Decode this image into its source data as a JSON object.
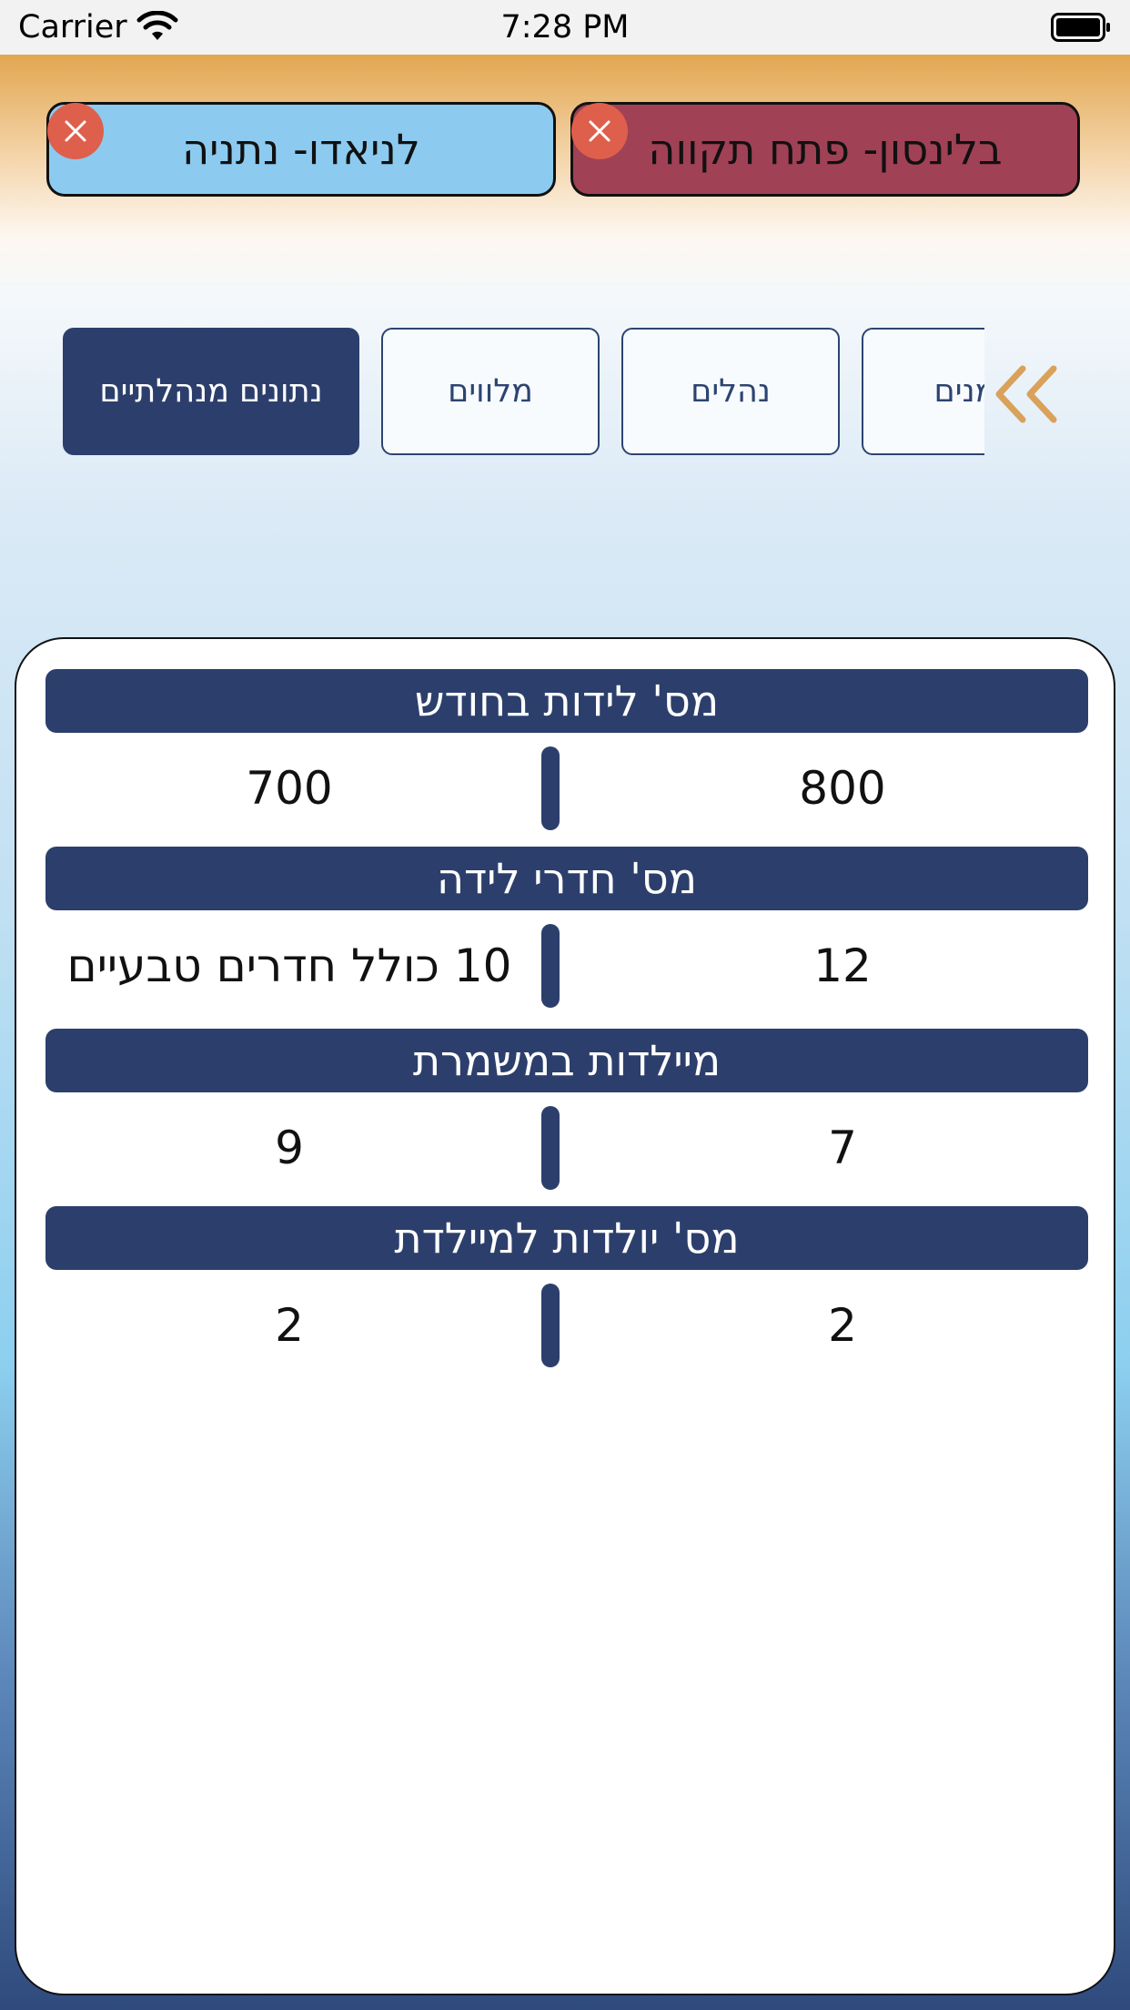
{
  "status_bar": {
    "carrier": "Carrier",
    "time": "7:28 PM"
  },
  "hospitals": {
    "left": "לניאדו- נתניה",
    "right": "בלינסון- פתח תקווה"
  },
  "tabs": [
    {
      "label": "נתונים מנהלתיים",
      "active": true
    },
    {
      "label": "מלווים",
      "active": false
    },
    {
      "label": "נהלים",
      "active": false
    },
    {
      "label": "זמנים",
      "active": false
    }
  ],
  "stats": [
    {
      "title": "מס' לידות בחודש",
      "left_value": "700",
      "right_value": "800"
    },
    {
      "title": "מס' חדרי לידה",
      "left_value": "10 כולל חדרים טבעיים",
      "right_value": "12"
    },
    {
      "title": "מיילדות במשמרת",
      "left_value": "9",
      "right_value": "7"
    },
    {
      "title": "מס' יולדות למיילדת",
      "left_value": "2",
      "right_value": "2"
    }
  ],
  "colors": {
    "primary_navy": "#2c3f6c",
    "hospital_left": "#8ccbef",
    "hospital_right": "#a14155",
    "close_badge": "#df5f4d",
    "chevron": "#d9a15a"
  },
  "icons": {
    "close": "close-icon",
    "scroll_tabs": "double-chevron-left-icon",
    "wifi": "wifi-icon",
    "battery": "battery-icon"
  }
}
